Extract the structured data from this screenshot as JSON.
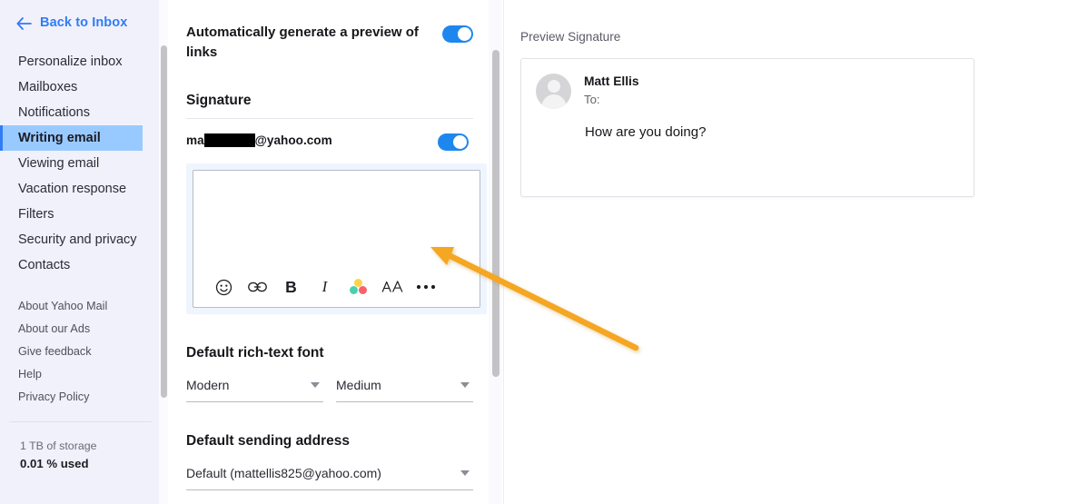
{
  "sidebar": {
    "back_link": {
      "label": "Back to Inbox",
      "icon": "arrow-left-icon"
    },
    "nav_items": [
      {
        "label": "Personalize inbox",
        "active": false
      },
      {
        "label": "Mailboxes",
        "active": false
      },
      {
        "label": "Notifications",
        "active": false
      },
      {
        "label": "Writing email",
        "active": true
      },
      {
        "label": "Viewing email",
        "active": false
      },
      {
        "label": "Vacation response",
        "active": false
      },
      {
        "label": "Filters",
        "active": false
      },
      {
        "label": "Security and privacy",
        "active": false
      },
      {
        "label": "Contacts",
        "active": false
      }
    ],
    "footer_links": [
      {
        "label": "About Yahoo Mail"
      },
      {
        "label": "About our Ads"
      },
      {
        "label": "Give feedback"
      },
      {
        "label": "Help"
      },
      {
        "label": "Privacy Policy"
      }
    ],
    "storage": {
      "total": "1 TB of storage",
      "used": "0.01 % used"
    }
  },
  "settings": {
    "link_preview": {
      "label": "Automatically generate a preview of links",
      "toggle_state": "on"
    },
    "signature": {
      "section_title": "Signature",
      "account_prefix": "ma",
      "account_suffix": "@yahoo.com",
      "toggle_state": "on",
      "editor_content": "",
      "toolbar": [
        {
          "name": "emoji-icon",
          "glyph": "☺"
        },
        {
          "name": "link-icon",
          "glyph": "link"
        },
        {
          "name": "bold-icon",
          "glyph": "B"
        },
        {
          "name": "italic-icon",
          "glyph": "I"
        },
        {
          "name": "text-color-icon",
          "glyph": "colors"
        },
        {
          "name": "font-size-icon",
          "glyph": "AA"
        },
        {
          "name": "more-options-icon",
          "glyph": "•••"
        }
      ]
    },
    "rich_text_font": {
      "section_title": "Default rich-text font",
      "family_value": "Modern",
      "size_value": "Medium"
    },
    "sending_address": {
      "section_title": "Default sending address",
      "value": "Default (mattellis825@yahoo.com)"
    }
  },
  "preview": {
    "title": "Preview Signature",
    "sender_name": "Matt Ellis",
    "to_label": "To:",
    "body": "How are you doing?"
  },
  "colors": {
    "accent_blue": "#2f7cf6",
    "toggle_blue": "#1e87ef",
    "active_nav_bg": "#99caff",
    "sidebar_bg": "#f1f1fb",
    "annotation_orange": "#f5a623"
  }
}
